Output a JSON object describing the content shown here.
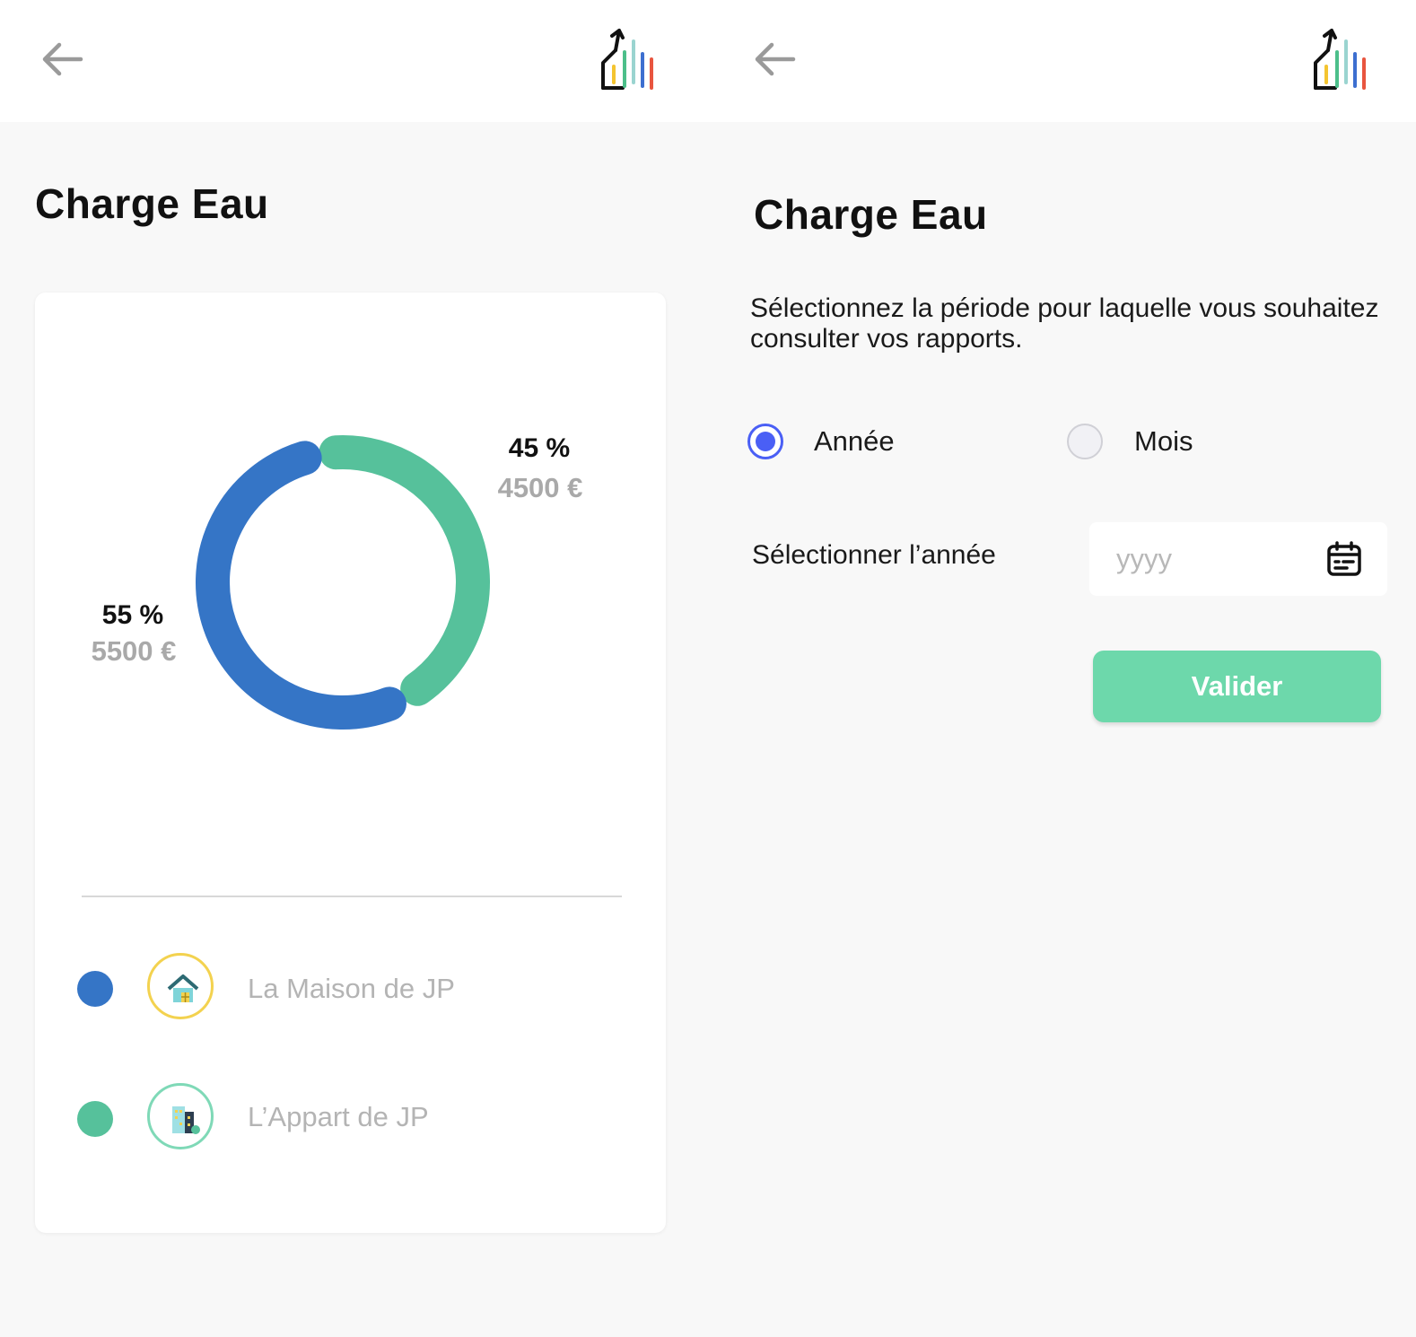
{
  "left_screen": {
    "title": "Charge Eau",
    "chart_data": {
      "type": "pie",
      "style": "donut",
      "slices": [
        {
          "label": "La Maison de JP",
          "percent": 55,
          "percent_label": "55 %",
          "amount_label": "5500 €",
          "color": "#3575c6"
        },
        {
          "label": "L’Appart de JP",
          "percent": 45,
          "percent_label": "45 %",
          "amount_label": "4500 €",
          "color": "#56c19b"
        }
      ]
    },
    "legend": [
      {
        "label": "La Maison de JP",
        "dot_color": "#3575c6",
        "ring_color": "#f3d24f",
        "icon": "house-icon"
      },
      {
        "label": "L’Appart de JP",
        "dot_color": "#56c19b",
        "ring_color": "#7fd9b7",
        "icon": "building-icon"
      }
    ]
  },
  "right_screen": {
    "title": "Charge Eau",
    "description": "Sélectionnez la période pour laquelle vous souhaitez consulter vos rapports.",
    "period_options": [
      {
        "label": "Année",
        "selected": true
      },
      {
        "label": "Mois",
        "selected": false
      }
    ],
    "year_field": {
      "label": "Sélectionner l’année",
      "placeholder": "yyyy",
      "value": ""
    },
    "submit_label": "Valider"
  },
  "colors": {
    "accent": "#4a5ff5",
    "button": "#6dd8ab",
    "series_1": "#3575c6",
    "series_2": "#56c19b"
  }
}
